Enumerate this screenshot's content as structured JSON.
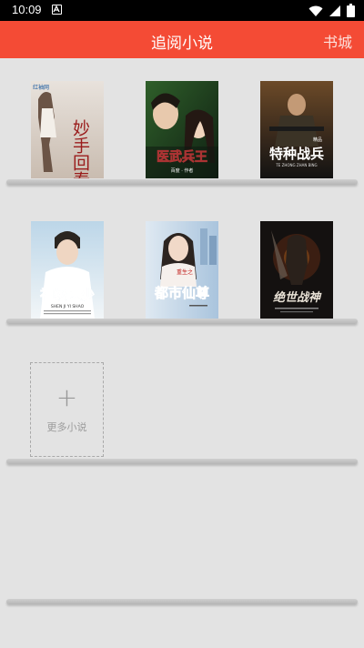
{
  "status_bar": {
    "time": "10:09",
    "icons": [
      "notification-a-icon",
      "wifi-icon",
      "signal-icon",
      "battery-icon"
    ]
  },
  "app_bar": {
    "title": "追阅小说",
    "store_label": "书城",
    "color": "#f44b35"
  },
  "shelf": {
    "books": [
      {
        "cover_title": "妙手回春",
        "publisher_tag": "红袖网",
        "icon": "book-cover"
      },
      {
        "cover_title": "医武兵王",
        "subtitle": "百度 · 作者",
        "icon": "book-cover"
      },
      {
        "cover_title": "特种战兵",
        "badge": "精品",
        "subtitle": "TE ZHONG ZHAN BING",
        "icon": "book-cover"
      },
      {
        "cover_title": "神级医少",
        "subtitle": "SHEN JI YI SHAO",
        "icon": "book-cover"
      },
      {
        "cover_title": "都市仙尊",
        "tagline": "重生之",
        "icon": "book-cover"
      },
      {
        "cover_title": "绝世战神",
        "icon": "book-cover"
      }
    ],
    "add_more_label": "更多小说"
  }
}
